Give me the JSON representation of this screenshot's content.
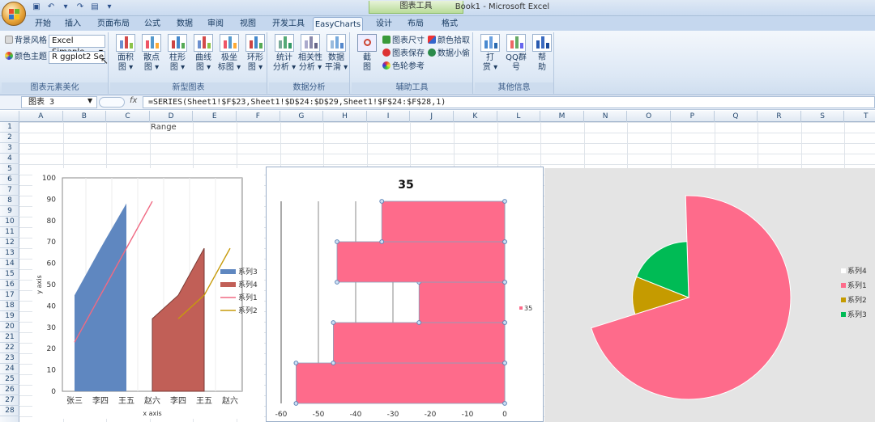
{
  "window": {
    "title": "Book1 - Microsoft Excel",
    "context_tab_group": "图表工具"
  },
  "tabs": [
    "开始",
    "插入",
    "页面布局",
    "公式",
    "数据",
    "审阅",
    "视图",
    "开发工具",
    "EasyCharts",
    "设计",
    "布局",
    "格式"
  ],
  "active_tab": "EasyCharts",
  "ribbon": {
    "group1": {
      "label": "图表元素美化",
      "bg_style_label": "背景风格",
      "bg_style_value": "Excel Simaple",
      "color_theme_label": "颜色主题",
      "color_theme_value": "R ggplot2 Se"
    },
    "group2": {
      "label": "新型图表",
      "buttons": [
        {
          "l1": "面积",
          "l2": "图 ▾"
        },
        {
          "l1": "散点",
          "l2": "图 ▾"
        },
        {
          "l1": "柱形",
          "l2": "图 ▾"
        },
        {
          "l1": "曲线",
          "l2": "图 ▾"
        },
        {
          "l1": "极坐",
          "l2": "标图 ▾"
        },
        {
          "l1": "环形",
          "l2": "图 ▾"
        }
      ]
    },
    "group3": {
      "label": "数据分析",
      "buttons": [
        {
          "l1": "统计",
          "l2": "分析 ▾"
        },
        {
          "l1": "相关性",
          "l2": "分析 ▾"
        },
        {
          "l1": "数据",
          "l2": "平滑 ▾"
        }
      ]
    },
    "group4": {
      "label": "辅助工具",
      "big": {
        "l1": "截",
        "l2": "图"
      },
      "small": [
        "图表尺寸",
        "图表保存",
        "色轮参考",
        "颜色拾取",
        "数据小偷"
      ]
    },
    "group5": {
      "label": "其他信息",
      "buttons": [
        {
          "l1": "打",
          "l2": "赏 ▾"
        },
        {
          "l1": "QQ群",
          "l2": "号"
        },
        {
          "l1": "帮",
          "l2": "助"
        }
      ]
    }
  },
  "formula_bar": {
    "name_box": "图表 3",
    "fx": "fx",
    "formula": "=SERIES(Sheet1!$F$23,Sheet1!$D$24:$D$29,Sheet1!$F$24:$F$28,1)"
  },
  "columns": [
    "A",
    "B",
    "C",
    "D",
    "E",
    "F",
    "G",
    "H",
    "I",
    "J",
    "K",
    "L",
    "M",
    "N",
    "O",
    "P",
    "Q",
    "R",
    "S",
    "T"
  ],
  "rows": [
    "1",
    "2",
    "3",
    "4",
    "5",
    "6",
    "7",
    "8",
    "9",
    "10",
    "11",
    "12",
    "13",
    "14",
    "15",
    "16",
    "17",
    "18",
    "19",
    "20",
    "21",
    "22",
    "23",
    "24",
    "25",
    "26",
    "27",
    "28"
  ],
  "cell_d1": "Range",
  "chart_data": [
    {
      "type": "area",
      "xlabel": "x axis",
      "ylabel": "y axis",
      "ylim": [
        0,
        100
      ],
      "yticks": [
        0,
        10,
        20,
        30,
        40,
        50,
        60,
        70,
        80,
        90,
        100
      ],
      "categories": [
        "张三",
        "李四",
        "王五",
        "赵六",
        "李四",
        "王五",
        "赵六"
      ],
      "series": [
        {
          "name": "系列3",
          "kind": "area",
          "color": "#5f87c0",
          "values": [
            45,
            67,
            88,
            null,
            null,
            null,
            null
          ]
        },
        {
          "name": "系列4",
          "kind": "area",
          "color": "#c15f57",
          "values": [
            null,
            null,
            null,
            34,
            45,
            67,
            null
          ]
        },
        {
          "name": "系列1",
          "kind": "line",
          "color": "#f06a83",
          "values": [
            23,
            45,
            67,
            89,
            null,
            null,
            null
          ]
        },
        {
          "name": "系列2",
          "kind": "line",
          "color": "#c79b0c",
          "values": [
            null,
            null,
            null,
            null,
            34,
            45,
            67
          ]
        }
      ],
      "legend": "right"
    },
    {
      "type": "bar",
      "title": "35",
      "orientation": "horizontal",
      "xlim": [
        -60,
        0
      ],
      "xticks": [
        -60,
        -50,
        -40,
        -30,
        -20,
        -10,
        0
      ],
      "values": [
        -56,
        -46,
        -23,
        -45,
        -33
      ],
      "series_name": "35",
      "color": "#fe6b8b",
      "legend": "right"
    },
    {
      "type": "pie",
      "style": "variable-radius",
      "slices": [
        {
          "name": "系列4",
          "value": 0,
          "radius_frac": 0,
          "color": "#ffffff"
        },
        {
          "name": "系列1",
          "value": 65,
          "radius_frac": 1.0,
          "color": "#fe6b8b"
        },
        {
          "name": "系列2",
          "value": 10,
          "radius_frac": 0.55,
          "color": "#c59b00"
        },
        {
          "name": "系列3",
          "value": 17,
          "radius_frac": 0.55,
          "color": "#00bb55"
        }
      ],
      "legend": "right"
    }
  ]
}
